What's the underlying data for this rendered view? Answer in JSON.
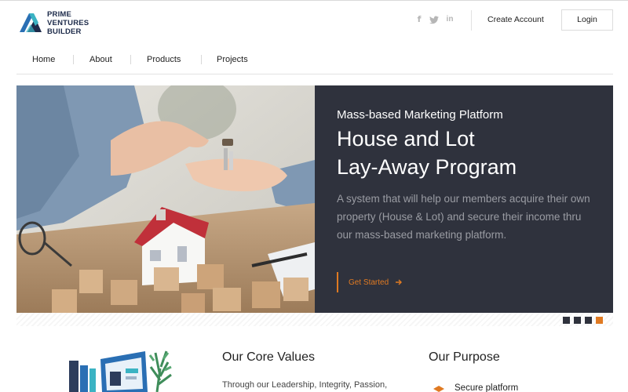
{
  "brand": {
    "line1": "PRIME",
    "line2": "VENTURES",
    "line3": "BUILDER",
    "colors": {
      "navy": "#1d2b4a",
      "blue": "#2a6fb4",
      "teal": "#3bb3c3"
    }
  },
  "header": {
    "social": [
      "facebook-icon",
      "twitter-icon",
      "linkedin-icon"
    ],
    "create_account": "Create Account",
    "login": "Login"
  },
  "nav": {
    "items": [
      {
        "label": "Home"
      },
      {
        "label": "About"
      },
      {
        "label": "Products"
      },
      {
        "label": "Projects"
      }
    ]
  },
  "hero": {
    "kicker": "Mass-based Marketing Platform",
    "title_line1": "House and Lot",
    "title_line2": "Lay-Away Program",
    "description": "A system that will help our members acquire their own property (House & Lot) and secure their income thru our mass-based marketing platform.",
    "cta": "Get Started",
    "slides": 4,
    "active_slide": 4,
    "colors": {
      "panel": "#2f323d",
      "accent": "#e07a22",
      "muted_text": "#9a9ca3"
    }
  },
  "sections": {
    "core_values": {
      "title": "Our Core Values",
      "text": "Through our Leadership, Integrity, Passion,"
    },
    "purpose": {
      "title": "Our Purpose",
      "first_item": "Secure platform"
    }
  }
}
